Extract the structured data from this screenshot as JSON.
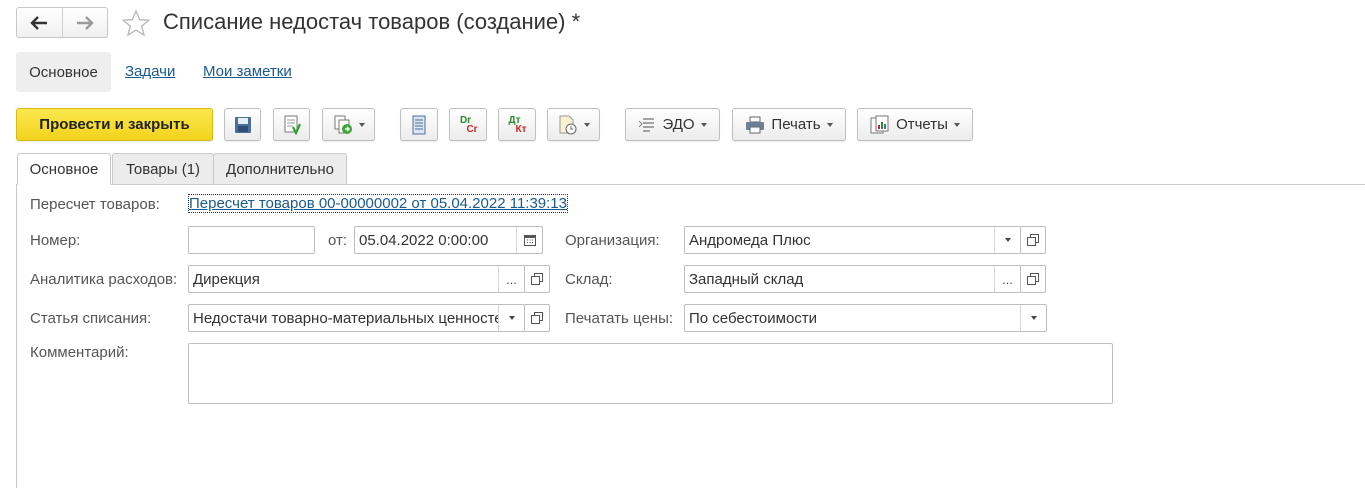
{
  "window": {
    "title": "Списание недостач товаров (создание) *"
  },
  "sections": {
    "main": "Основное",
    "tasks": "Задачи",
    "notes": "Мои заметки"
  },
  "toolbar": {
    "post_close_label": "Провести и закрыть",
    "edo_label": "ЭДО",
    "print_label": "Печать",
    "reports_label": "Отчеты",
    "dtkt_top": "Dr",
    "dtkt_bottom": "Cr",
    "dtkt2_top": "Дт",
    "dtkt2_bottom": "Кт"
  },
  "tabs": [
    {
      "label": "Основное",
      "active": true
    },
    {
      "label": "Товары (1)",
      "active": false
    },
    {
      "label": "Дополнительно",
      "active": false
    }
  ],
  "form": {
    "recount_label": "Пересчет товаров:",
    "recount_link": "Пересчет товаров 00-00000002 от 05.04.2022 11:39:13",
    "number_label": "Номер:",
    "number_value": "",
    "date_label": "от:",
    "date_value": "05.04.2022  0:00:00",
    "org_label": "Организация:",
    "org_value": "Андромеда Плюс",
    "analytics_label": "Аналитика расходов:",
    "analytics_value": "Дирекция",
    "warehouse_label": "Склад:",
    "warehouse_value": "Западный склад",
    "article_label": "Статья списания:",
    "article_value": "Недостачи товарно-материальных ценностей",
    "prices_label": "Печатать цены:",
    "prices_value": "По себестоимости",
    "comment_label": "Комментарий:",
    "comment_value": "",
    "choice_glyph": "..."
  },
  "colors": {
    "primary_button": "#f2d31c",
    "link": "#1a5a8f"
  }
}
